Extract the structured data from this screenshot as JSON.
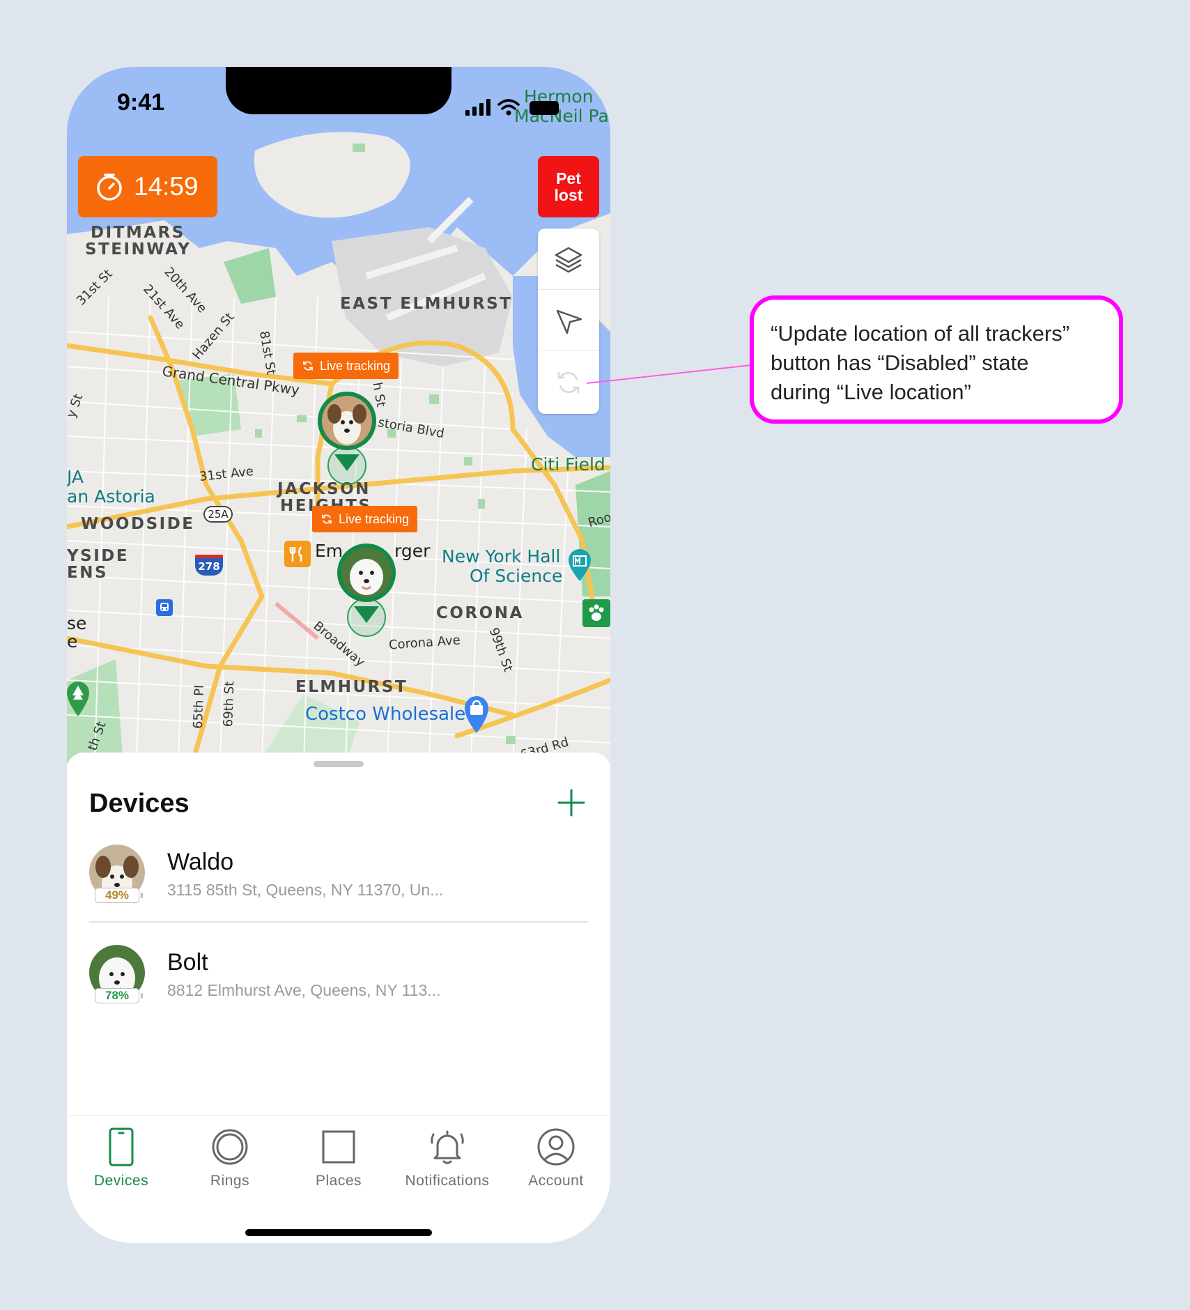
{
  "status_bar": {
    "time": "9:41"
  },
  "timer": {
    "value": "14:59",
    "icon": "stopwatch-icon"
  },
  "pet_lost": {
    "label_line1": "Pet",
    "label_line2": "lost"
  },
  "map_controls": [
    {
      "icon": "layers-icon",
      "state": "enabled"
    },
    {
      "icon": "navigation-arrow-icon",
      "state": "enabled"
    },
    {
      "icon": "refresh-icon",
      "state": "disabled"
    }
  ],
  "map": {
    "areas": [
      "DITMARS",
      "STEINWAY",
      "EAST ELMHURST",
      "JACKSON",
      "HEIGHTS",
      "WOODSIDE",
      "YSIDE",
      "ENS",
      "CORONA",
      "ELMHURST"
    ],
    "streets": [
      "31st St",
      "20th Ave",
      "21st Ave",
      "Hazen St",
      "81st St",
      "Grand Central Pkwy",
      "h St",
      "storia Blvd",
      "31st Ave",
      "Broadway",
      "Corona Ave",
      "99th St",
      "65th Pl",
      "69th St",
      "63rd Rd",
      "Roo",
      "y St",
      "th St"
    ],
    "pois": [
      "Hermon",
      "MacNeil Pa",
      "Citi Field",
      "JA",
      "an Astoria",
      "New York Hall",
      "Of Science",
      "Costco Wholesale",
      "Em",
      "rger",
      "se",
      "e"
    ],
    "shields": [
      "25A",
      "278"
    ]
  },
  "live_tracking": {
    "label": "Live tracking"
  },
  "sheet": {
    "title": "Devices",
    "devices": [
      {
        "name": "Waldo",
        "address": "3115 85th St, Queens, NY 11370, Un...",
        "battery": "49%",
        "battery_color": "#b3862a"
      },
      {
        "name": "Bolt",
        "address": "8812 Elmhurst Ave, Queens, NY 113...",
        "battery": "78%",
        "battery_color": "#1f9a4c"
      }
    ]
  },
  "tabs": [
    {
      "label": "Devices",
      "icon": "phone-icon",
      "active": true
    },
    {
      "label": "Rings",
      "icon": "ring-icon",
      "active": false
    },
    {
      "label": "Places",
      "icon": "square-icon",
      "active": false
    },
    {
      "label": "Notifications",
      "icon": "bell-icon",
      "active": false
    },
    {
      "label": "Account",
      "icon": "user-icon",
      "active": false
    }
  ],
  "callout": {
    "line1": "“Update location of all trackers”",
    "line2": "button has “Disabled” state",
    "line3": "during “Live location”"
  },
  "colors": {
    "accent_green": "#14894a",
    "orange": "#f76b0b",
    "red": "#f01414",
    "callout_border": "#ff00ff"
  }
}
